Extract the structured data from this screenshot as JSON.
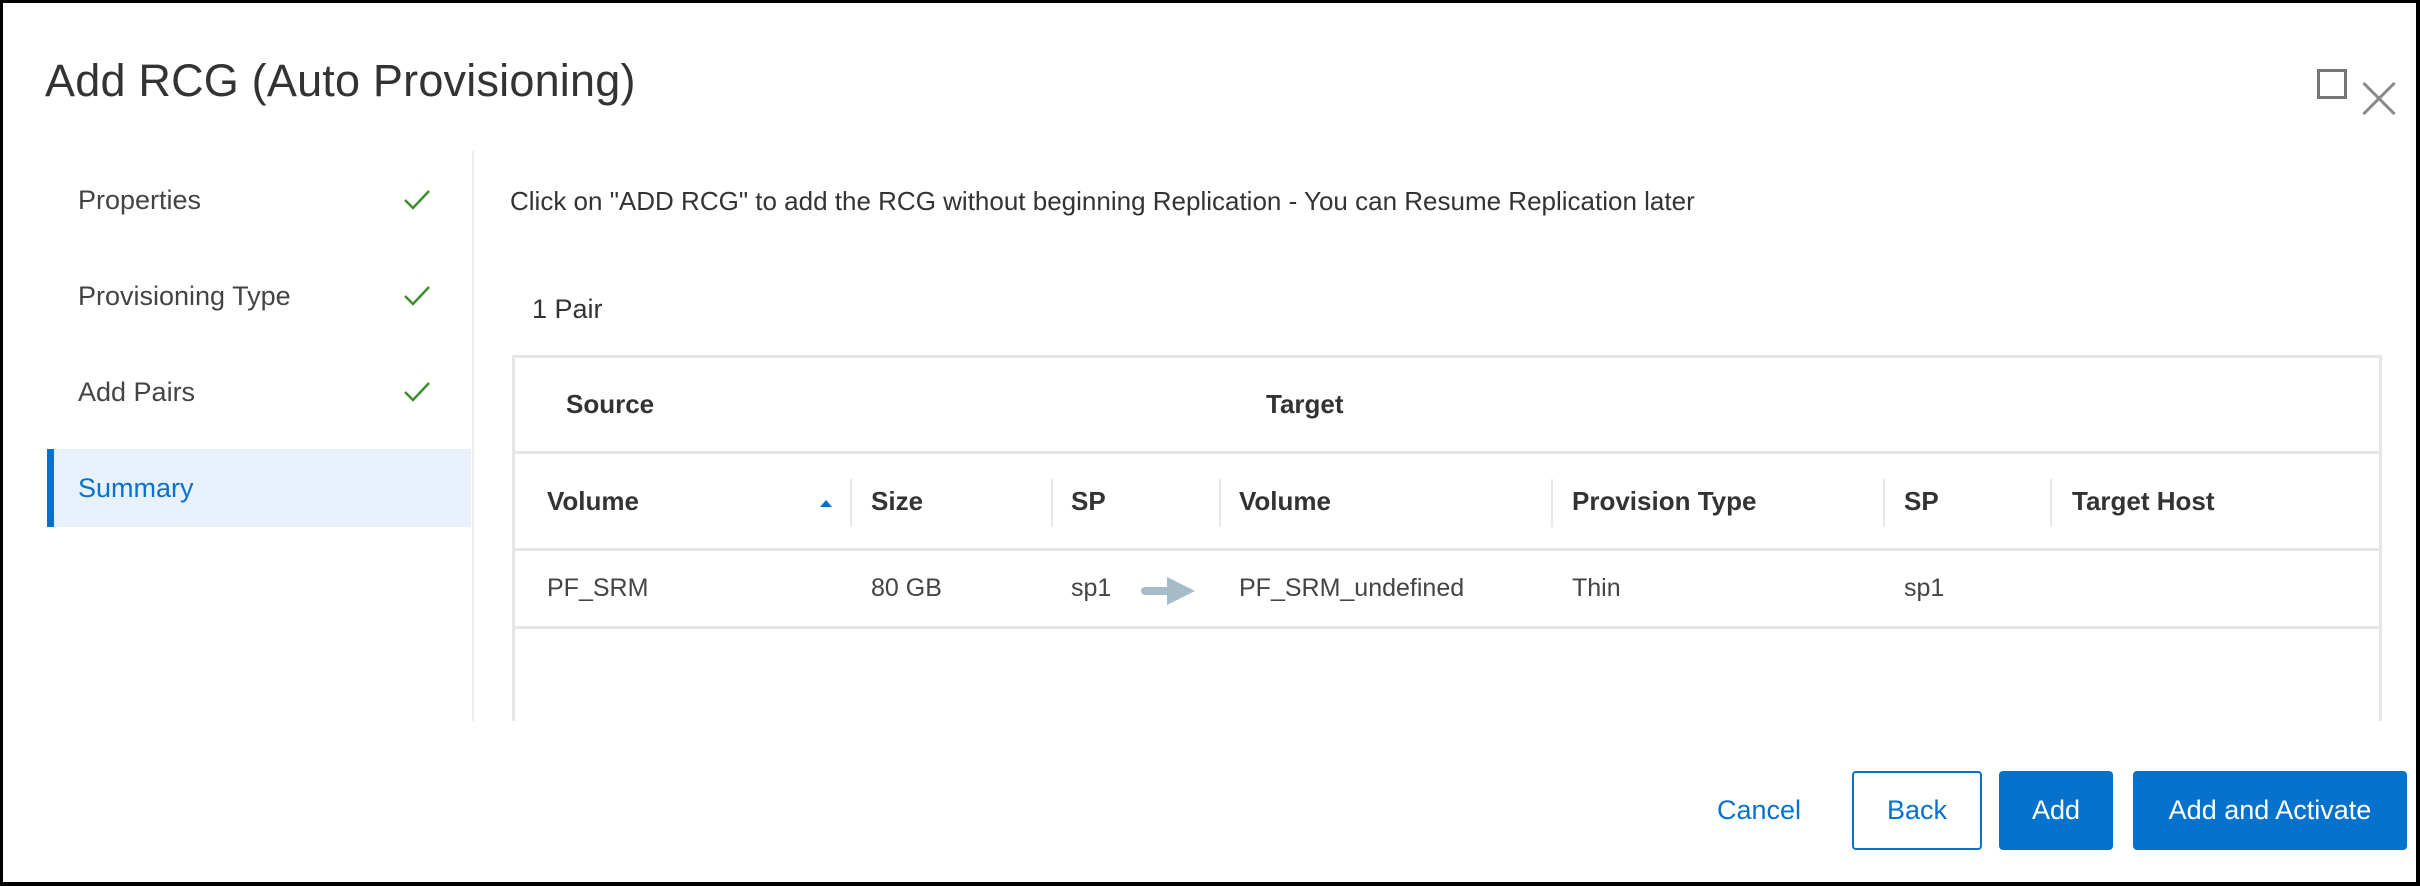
{
  "dialog": {
    "title": "Add RCG (Auto Provisioning)",
    "window_controls": [
      {
        "name": "maximize",
        "icon": "square-icon"
      },
      {
        "name": "close",
        "icon": "close-icon"
      }
    ]
  },
  "steps": [
    {
      "label": "Properties",
      "status": "complete",
      "icon": "check-icon"
    },
    {
      "label": "Provisioning Type",
      "status": "complete",
      "icon": "check-icon"
    },
    {
      "label": "Add Pairs",
      "status": "complete",
      "icon": "check-icon"
    },
    {
      "label": "Summary",
      "status": "active"
    }
  ],
  "main": {
    "instruction": "Click on \"ADD RCG\" to add the RCG without beginning Replication - You can Resume Replication later",
    "pair_count": "1 Pair",
    "table": {
      "groups": [
        "Source",
        "Target"
      ],
      "columns": [
        "Volume",
        "Size",
        "SP",
        "Volume",
        "Provision Type",
        "SP",
        "Target Host"
      ],
      "sort": {
        "column": "Volume",
        "direction": "ascending"
      },
      "rows": [
        {
          "source_volume": "PF_SRM",
          "size": "80 GB",
          "source_sp": "sp1",
          "target_volume": "PF_SRM_undefined",
          "provision_type": "Thin",
          "target_sp": "sp1",
          "target_host": ""
        }
      ]
    }
  },
  "footer": {
    "cancel": "Cancel",
    "back": "Back",
    "add": "Add",
    "add_activate": "Add and Activate"
  },
  "colors": {
    "accent": "#0672cb",
    "check": "#3d8a2e",
    "arrow": "#a6bcc9",
    "active_step_bg": "#e8f1fb"
  }
}
